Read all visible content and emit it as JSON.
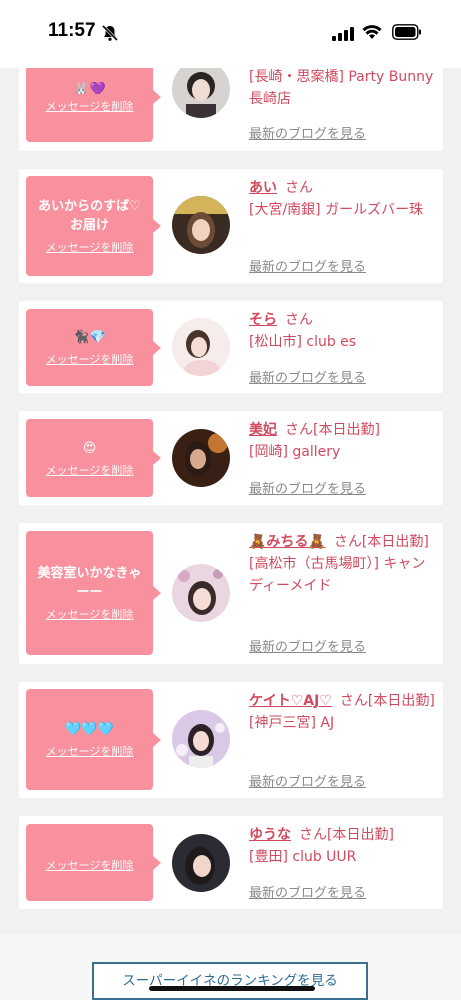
{
  "status": {
    "time": "11:57"
  },
  "delete_label": "メッセージを削除",
  "blog_label": "最新のブログを見る",
  "san_label": "さん",
  "cards": [
    {
      "message": "",
      "name": "",
      "suffix": "",
      "shop": "[長崎・思案橋] Party Bunny 長崎店"
    },
    {
      "message": "あいからのすば♡お届け",
      "name": "あい",
      "suffix": "",
      "shop": "[大宮/南銀] ガールズバー珠"
    },
    {
      "message": "🐈‍⬛💎",
      "name": "そら",
      "suffix": "",
      "shop": "[松山市] club es"
    },
    {
      "message": "😍",
      "name": "美妃",
      "suffix": "[本日出勤]",
      "shop": "[岡崎] gallery"
    },
    {
      "message": "美容室いかなきゃーー",
      "name": "🧸みちる🧸",
      "suffix": "[本日出勤]",
      "shop": "[高松市（古馬場町）] キャンディーメイド"
    },
    {
      "message": "🩵🩵🩵",
      "name": "ケイト♡AJ♡",
      "suffix": "[本日出勤]",
      "shop": "[神戸三宮] AJ"
    },
    {
      "message": "",
      "name": "ゆうな",
      "suffix": "[本日出勤]",
      "shop": "[豊田] club UUR"
    }
  ],
  "ranking_button": "スーパーイイネのランキングを見る"
}
